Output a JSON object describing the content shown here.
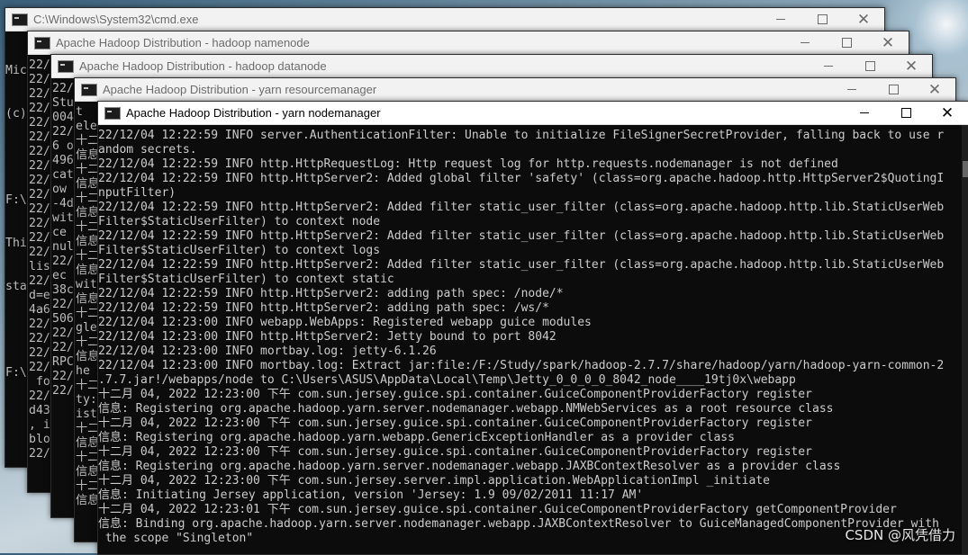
{
  "windows": [
    {
      "title": "C:\\Windows\\System32\\cmd.exe",
      "lines": [
        "Mic",
        "(c)",
        "",
        "F:\\",
        "Thi",
        "sta",
        "",
        "F:\\"
      ]
    },
    {
      "title": "Apache Hadoop Distribution - hadoop   namenode",
      "lines": [
        "22/",
        "22/",
        "22/",
        "22/",
        "22/",
        "22/",
        "22/",
        "22/",
        "22/",
        "22/",
        "22/",
        "22/",
        "22/",
        "22/",
        "lis",
        "22/",
        "d=e",
        "4a6",
        "22/",
        "22/",
        "22/",
        "22/",
        " fo",
        "22/",
        "d43",
        ", i",
        "blo",
        "22/"
      ]
    },
    {
      "title": "Apache Hadoop Distribution - hadoop   datanode",
      "lines": [
        "22/",
        "Stu",
        "004",
        "22/",
        "6 o",
        "496",
        "cat",
        "ow",
        "-4d",
        "wit",
        "ce",
        "nul",
        "22/",
        "ec",
        "38c",
        "22/",
        "506",
        "22/",
        "22/",
        "RPC",
        "22/",
        "22/"
      ]
    },
    {
      "title": "Apache Hadoop Distribution - yarn   resourcemanager",
      "lines": [
        "t",
        "ele",
        "十二",
        "信息",
        "十二",
        "信息",
        "十二",
        "信息",
        "十二",
        "信息",
        "十二",
        "信息",
        "wit",
        "信息",
        "十二",
        "gle",
        "十二",
        "信息",
        "he",
        "十二",
        "ty:",
        "ist",
        "十二",
        "信息",
        "十二",
        "信息",
        "十二",
        "信息"
      ]
    },
    {
      "title": "Apache Hadoop Distribution - yarn   nodemanager",
      "lines": [
        "22/12/04 12:22:59 INFO server.AuthenticationFilter: Unable to initialize FileSignerSecretProvider, falling back to use r",
        "andom secrets.",
        "22/12/04 12:22:59 INFO http.HttpRequestLog: Http request log for http.requests.nodemanager is not defined",
        "22/12/04 12:22:59 INFO http.HttpServer2: Added global filter 'safety' (class=org.apache.hadoop.http.HttpServer2$QuotingI",
        "nputFilter)",
        "22/12/04 12:22:59 INFO http.HttpServer2: Added filter static_user_filter (class=org.apache.hadoop.http.lib.StaticUserWeb",
        "Filter$StaticUserFilter) to context node",
        "22/12/04 12:22:59 INFO http.HttpServer2: Added filter static_user_filter (class=org.apache.hadoop.http.lib.StaticUserWeb",
        "Filter$StaticUserFilter) to context logs",
        "22/12/04 12:22:59 INFO http.HttpServer2: Added filter static_user_filter (class=org.apache.hadoop.http.lib.StaticUserWeb",
        "Filter$StaticUserFilter) to context static",
        "22/12/04 12:22:59 INFO http.HttpServer2: adding path spec: /node/*",
        "22/12/04 12:22:59 INFO http.HttpServer2: adding path spec: /ws/*",
        "22/12/04 12:23:00 INFO webapp.WebApps: Registered webapp guice modules",
        "22/12/04 12:23:00 INFO http.HttpServer2: Jetty bound to port 8042",
        "22/12/04 12:23:00 INFO mortbay.log: jetty-6.1.26",
        "22/12/04 12:23:00 INFO mortbay.log: Extract jar:file:/F:/Study/spark/hadoop-2.7.7/share/hadoop/yarn/hadoop-yarn-common-2",
        ".7.7.jar!/webapps/node to C:\\Users\\ASUS\\AppData\\Local\\Temp\\Jetty_0_0_0_0_8042_node____19tj0x\\webapp",
        "十二月 04, 2022 12:23:00 下午 com.sun.jersey.guice.spi.container.GuiceComponentProviderFactory register",
        "信息: Registering org.apache.hadoop.yarn.server.nodemanager.webapp.NMWebServices as a root resource class",
        "十二月 04, 2022 12:23:00 下午 com.sun.jersey.guice.spi.container.GuiceComponentProviderFactory register",
        "信息: Registering org.apache.hadoop.yarn.webapp.GenericExceptionHandler as a provider class",
        "十二月 04, 2022 12:23:00 下午 com.sun.jersey.guice.spi.container.GuiceComponentProviderFactory register",
        "信息: Registering org.apache.hadoop.yarn.server.nodemanager.webapp.JAXBContextResolver as a provider class",
        "十二月 04, 2022 12:23:00 下午 com.sun.jersey.server.impl.application.WebApplicationImpl _initiate",
        "信息: Initiating Jersey application, version 'Jersey: 1.9 09/02/2011 11:17 AM'",
        "十二月 04, 2022 12:23:01 下午 com.sun.jersey.guice.spi.container.GuiceComponentProviderFactory getComponentProvider",
        "信息: Binding org.apache.hadoop.yarn.server.nodemanager.webapp.JAXBContextResolver to GuiceManagedComponentProvider with",
        " the scope \"Singleton\""
      ]
    }
  ],
  "controls": {
    "minimize": "—",
    "maximize": "☐",
    "close": "✕"
  },
  "watermark": "CSDN @风凭借力"
}
